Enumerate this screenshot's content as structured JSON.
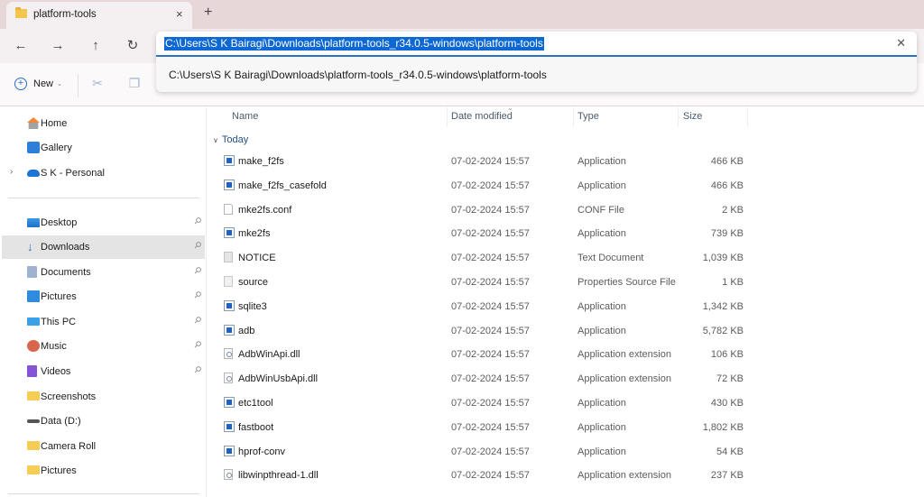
{
  "window": {
    "tab_title": "platform-tools",
    "tab_close_icon": "×",
    "new_tab_icon": "+"
  },
  "nav": {
    "back_icon": "←",
    "forward_icon": "→",
    "up_icon": "↑",
    "refresh_icon": "↻"
  },
  "address": {
    "value": "C:\\Users\\S K Bairagi\\Downloads\\platform-tools_r34.0.5-windows\\platform-tools",
    "clear_icon": "✕",
    "suggestion": "C:\\Users\\S K Bairagi\\Downloads\\platform-tools_r34.0.5-windows\\platform-tools"
  },
  "toolbar": {
    "new_label": "New",
    "new_icon": "+",
    "new_chevron": "⌄",
    "cut_icon": "✂",
    "copy_icon": "❐"
  },
  "sidebar": {
    "pin_icon": "📌",
    "items": [
      {
        "label": "Home",
        "icon": "home-icon"
      },
      {
        "label": "Gallery",
        "icon": "gallery-icon"
      },
      {
        "label": "S K - Personal",
        "icon": "onedrive-icon",
        "expandable": true
      },
      {
        "label": "Desktop",
        "icon": "desktop-icon",
        "pinned": true
      },
      {
        "label": "Downloads",
        "icon": "downloads-icon",
        "pinned": true,
        "selected": true
      },
      {
        "label": "Documents",
        "icon": "documents-icon",
        "pinned": true
      },
      {
        "label": "Pictures",
        "icon": "pictures-icon",
        "pinned": true
      },
      {
        "label": "This PC",
        "icon": "this-pc-icon",
        "pinned": true
      },
      {
        "label": "Music",
        "icon": "music-icon",
        "pinned": true
      },
      {
        "label": "Videos",
        "icon": "videos-icon",
        "pinned": true
      },
      {
        "label": "Screenshots",
        "icon": "folder-icon"
      },
      {
        "label": "Data (D:)",
        "icon": "drive-icon"
      },
      {
        "label": "Camera Roll",
        "icon": "folder-icon"
      },
      {
        "label": "Pictures",
        "icon": "folder-icon"
      }
    ]
  },
  "content": {
    "columns": [
      "Name",
      "Date modified",
      "Type",
      "Size"
    ],
    "group_label": "Today",
    "files": [
      {
        "name": "make_f2fs",
        "date": "07-02-2024 15:57",
        "type": "Application",
        "size": "466 KB",
        "icon": "app"
      },
      {
        "name": "make_f2fs_casefold",
        "date": "07-02-2024 15:57",
        "type": "Application",
        "size": "466 KB",
        "icon": "app"
      },
      {
        "name": "mke2fs.conf",
        "date": "07-02-2024 15:57",
        "type": "CONF File",
        "size": "2 KB",
        "icon": "conf"
      },
      {
        "name": "mke2fs",
        "date": "07-02-2024 15:57",
        "type": "Application",
        "size": "739 KB",
        "icon": "app"
      },
      {
        "name": "NOTICE",
        "date": "07-02-2024 15:57",
        "type": "Text Document",
        "size": "1,039 KB",
        "icon": "text"
      },
      {
        "name": "source",
        "date": "07-02-2024 15:57",
        "type": "Properties Source File",
        "size": "1 KB",
        "icon": "prop"
      },
      {
        "name": "sqlite3",
        "date": "07-02-2024 15:57",
        "type": "Application",
        "size": "1,342 KB",
        "icon": "app"
      },
      {
        "name": "adb",
        "date": "07-02-2024 15:57",
        "type": "Application",
        "size": "5,782 KB",
        "icon": "app"
      },
      {
        "name": "AdbWinApi.dll",
        "date": "07-02-2024 15:57",
        "type": "Application extension",
        "size": "106 KB",
        "icon": "dll"
      },
      {
        "name": "AdbWinUsbApi.dll",
        "date": "07-02-2024 15:57",
        "type": "Application extension",
        "size": "72 KB",
        "icon": "dll"
      },
      {
        "name": "etc1tool",
        "date": "07-02-2024 15:57",
        "type": "Application",
        "size": "430 KB",
        "icon": "app"
      },
      {
        "name": "fastboot",
        "date": "07-02-2024 15:57",
        "type": "Application",
        "size": "1,802 KB",
        "icon": "app"
      },
      {
        "name": "hprof-conv",
        "date": "07-02-2024 15:57",
        "type": "Application",
        "size": "54 KB",
        "icon": "app"
      },
      {
        "name": "libwinpthread-1.dll",
        "date": "07-02-2024 15:57",
        "type": "Application extension",
        "size": "237 KB",
        "icon": "dll"
      }
    ]
  }
}
